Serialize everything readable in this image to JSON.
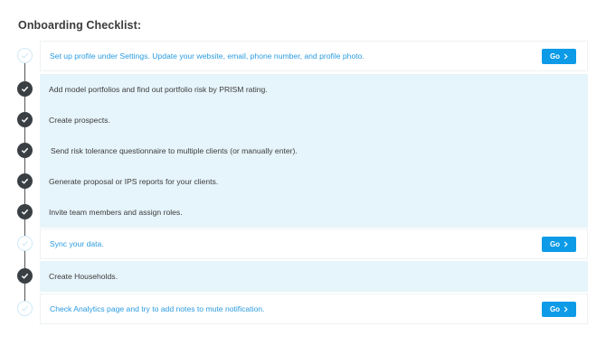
{
  "page": {
    "title": "Onboarding Checklist:"
  },
  "colors": {
    "done_card_bg": "#e6f4fb",
    "pending_text": "#2b9be0",
    "go_button": "#0d9be8",
    "done_marker": "#3a3f44"
  },
  "icons": {
    "done": "check-circle-icon",
    "pending": "check-circle-outline-icon",
    "go": "chevron-right-icon"
  },
  "steps": [
    {
      "text": "Set up profile under Settings. Update your website, email, phone number, and profile photo.",
      "status": "pending",
      "button": "Go"
    },
    {
      "text": "Add model portfolios and find out portfolio risk by PRISM rating.",
      "status": "done"
    },
    {
      "text": "Create prospects.",
      "status": "done"
    },
    {
      "text": "Send risk tolerance questionnaire to multiple clients (or manually enter).",
      "status": "done"
    },
    {
      "text": "Generate proposal or IPS reports for your clients.",
      "status": "done"
    },
    {
      "text": "Invite team members and assign roles.",
      "status": "done"
    },
    {
      "text": "Sync your data.",
      "status": "pending",
      "button": "Go"
    },
    {
      "text": "Create Households.",
      "status": "done"
    },
    {
      "text": "Check Analytics page and try to add notes to mute notification.",
      "status": "pending",
      "button": "Go"
    }
  ]
}
